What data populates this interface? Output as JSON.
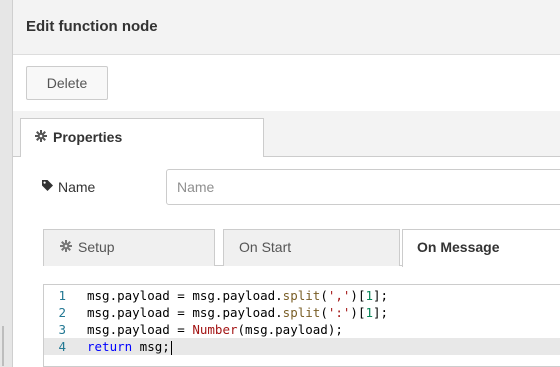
{
  "window": {
    "title": "Edit function node"
  },
  "toolbar": {
    "delete_label": "Delete"
  },
  "tabs": {
    "properties_label": "Properties"
  },
  "properties": {
    "name_label": "Name",
    "name_placeholder": "Name",
    "name_value": ""
  },
  "func_tabs": [
    {
      "label": "Setup",
      "selected": false,
      "icon": "gear-icon"
    },
    {
      "label": "On Start",
      "selected": false
    },
    {
      "label": "On Message",
      "selected": true
    }
  ],
  "editor": {
    "lines": [
      {
        "num": "1",
        "tokens": [
          {
            "t": "msg.payload = msg.payload.",
            "c": "plain"
          },
          {
            "t": "split",
            "c": "call"
          },
          {
            "t": "(",
            "c": "plain"
          },
          {
            "t": "','",
            "c": "str"
          },
          {
            "t": ")[",
            "c": "plain"
          },
          {
            "t": "1",
            "c": "num"
          },
          {
            "t": "];",
            "c": "plain"
          }
        ]
      },
      {
        "num": "2",
        "tokens": [
          {
            "t": "msg.payload = msg.payload.",
            "c": "plain"
          },
          {
            "t": "split",
            "c": "call"
          },
          {
            "t": "(",
            "c": "plain"
          },
          {
            "t": "':'",
            "c": "str"
          },
          {
            "t": ")[",
            "c": "plain"
          },
          {
            "t": "1",
            "c": "num"
          },
          {
            "t": "];",
            "c": "plain"
          }
        ]
      },
      {
        "num": "3",
        "tokens": [
          {
            "t": "msg.payload = ",
            "c": "plain"
          },
          {
            "t": "Number",
            "c": "str"
          },
          {
            "t": "(msg.payload);",
            "c": "plain"
          }
        ]
      },
      {
        "num": "4",
        "active": true,
        "tokens": [
          {
            "t": "return",
            "c": "kw"
          },
          {
            "t": " msg;",
            "c": "plain"
          }
        ]
      }
    ]
  },
  "colors": {
    "header_bg": "#f3f3f3",
    "border": "#cccccc",
    "line_number": "#237893",
    "string": "#a31515",
    "keyword": "#0000ff",
    "number": "#098658",
    "active_line_bg": "#e8e8e8"
  }
}
